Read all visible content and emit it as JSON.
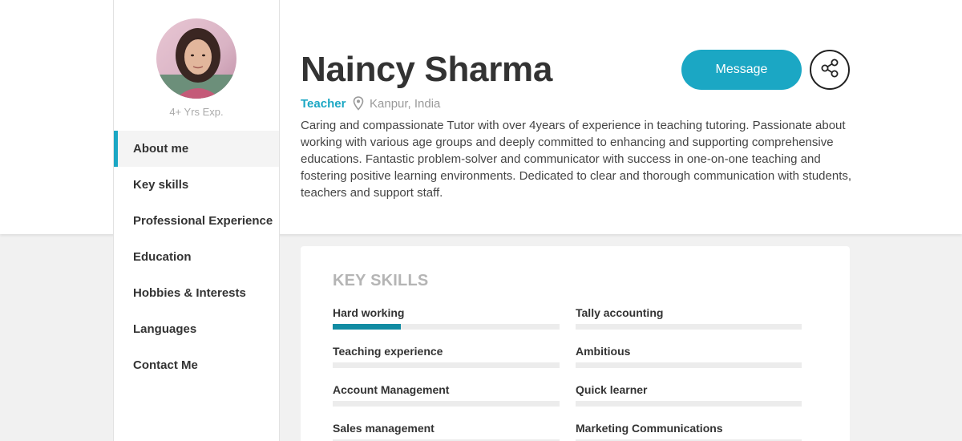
{
  "profile": {
    "name": "Naincy Sharma",
    "role": "Teacher",
    "location": "Kanpur, India",
    "experience": "4+ Yrs Exp.",
    "about": "Caring and compassionate Tutor with over 4years of experience in teaching tutoring. Passionate about working with various age groups and deeply committed to enhancing and supporting comprehensive educations. Fantastic problem-solver and communicator with success in one-on-one teaching and fostering positive learning environments. Dedicated to clear and thorough communication with students, teachers and support staff."
  },
  "actions": {
    "message_label": "Message",
    "share_icon": "share-icon"
  },
  "nav": {
    "items": [
      {
        "label": "About me",
        "active": true
      },
      {
        "label": "Key skills",
        "active": false
      },
      {
        "label": "Professional Experience",
        "active": false
      },
      {
        "label": "Education",
        "active": false
      },
      {
        "label": "Hobbies & Interests",
        "active": false
      },
      {
        "label": "Languages",
        "active": false
      },
      {
        "label": "Contact Me",
        "active": false
      }
    ]
  },
  "skills": {
    "title": "KEY SKILLS",
    "items": [
      {
        "label": "Hard working",
        "level": 0.3
      },
      {
        "label": "Tally accounting",
        "level": 0
      },
      {
        "label": "Teaching experience",
        "level": 0
      },
      {
        "label": "Ambitious",
        "level": 0
      },
      {
        "label": "Account Management",
        "level": 0
      },
      {
        "label": "Quick learner",
        "level": 0
      },
      {
        "label": "Sales management",
        "level": 0
      },
      {
        "label": "Marketing Communications",
        "level": 0
      }
    ]
  },
  "colors": {
    "accent": "#1ba7c4",
    "bar_fill": "#128ca3",
    "bar_track": "#ececec"
  }
}
